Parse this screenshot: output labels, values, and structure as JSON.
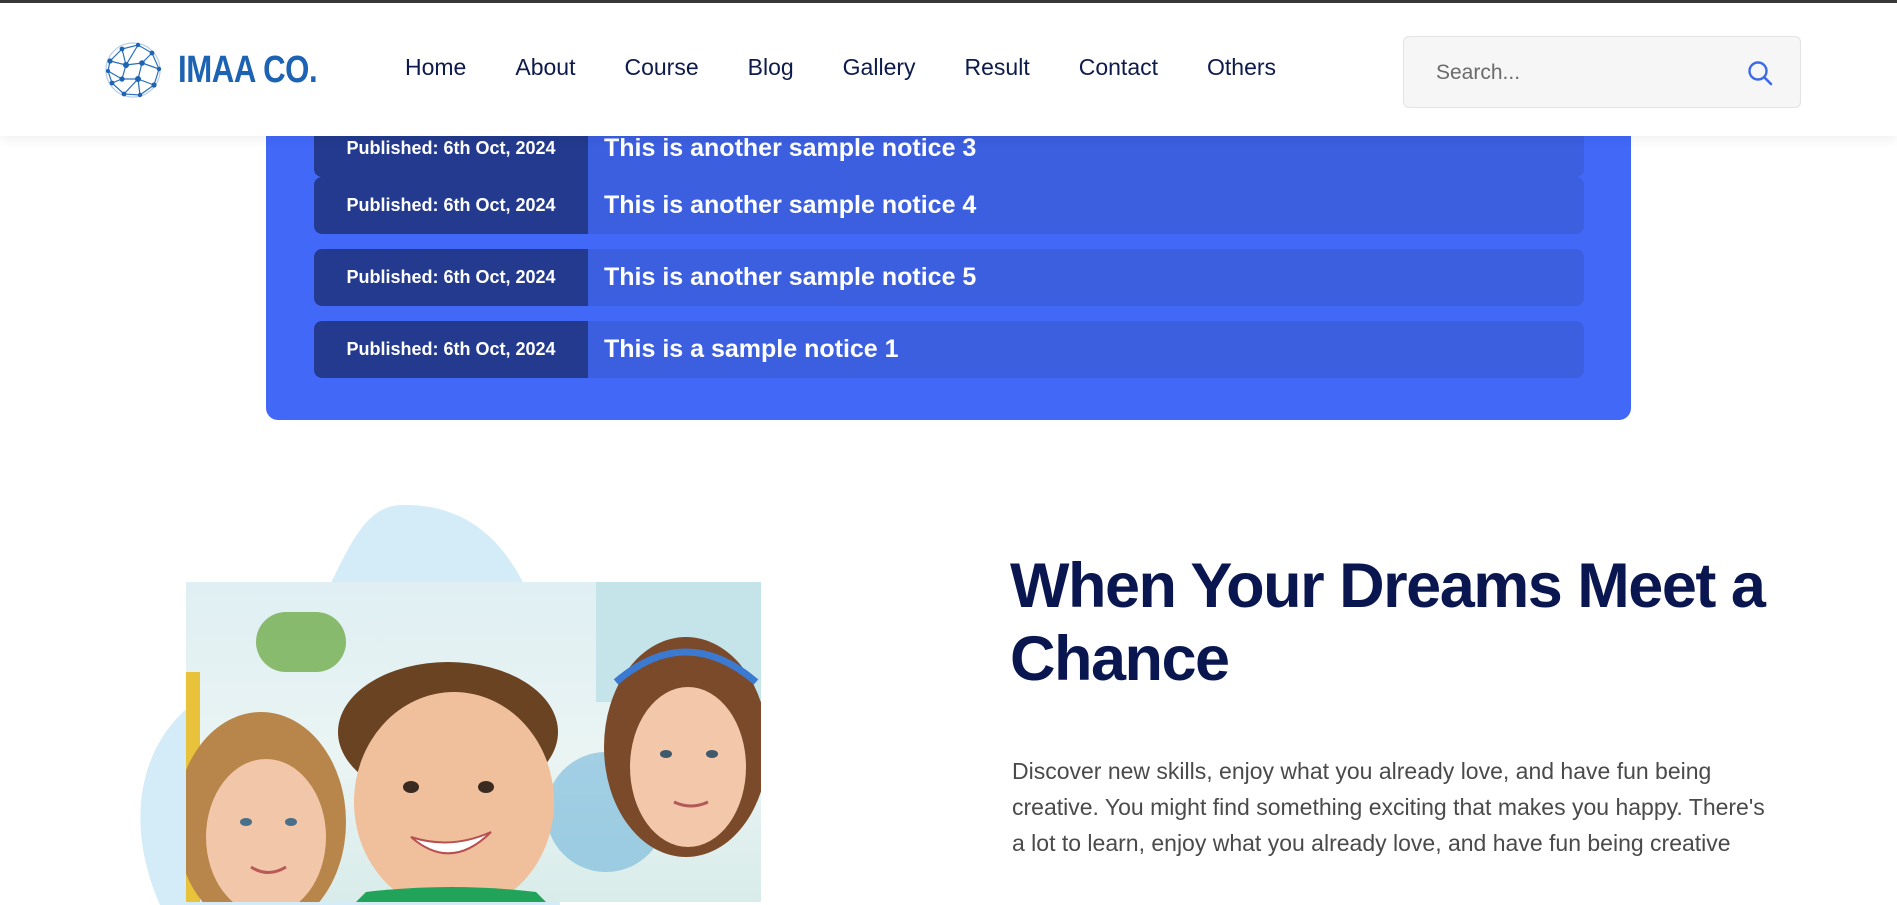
{
  "brand": {
    "name": "IMAA CO.",
    "color": "#1d63b3"
  },
  "nav": {
    "items": [
      {
        "label": "Home"
      },
      {
        "label": "About"
      },
      {
        "label": "Course"
      },
      {
        "label": "Blog"
      },
      {
        "label": "Gallery"
      },
      {
        "label": "Result"
      },
      {
        "label": "Contact"
      },
      {
        "label": "Others"
      }
    ]
  },
  "search": {
    "placeholder": "Search...",
    "value": "",
    "icon": "search-icon"
  },
  "notices": [
    {
      "date": "Published: 6th Oct, 2024",
      "title": "This is another sample notice 3"
    },
    {
      "date": "Published: 6th Oct, 2024",
      "title": "This is another sample notice 4"
    },
    {
      "date": "Published: 6th Oct, 2024",
      "title": "This is another sample notice 5"
    },
    {
      "date": "Published: 6th Oct, 2024",
      "title": "This is a sample notice 1"
    }
  ],
  "hero": {
    "title": "When Your Dreams Meet a Chance",
    "description": "Discover new skills, enjoy what you already love, and have fun being creative. You might find something exciting that makes you happy. There's a lot to learn, enjoy what you already love, and have fun being creative"
  },
  "colors": {
    "accent": "#4268f8",
    "notice_row": "#3c5fe0",
    "notice_date": "#233a8e",
    "heading": "#0a1650",
    "nav_text": "#0d1a4c"
  }
}
